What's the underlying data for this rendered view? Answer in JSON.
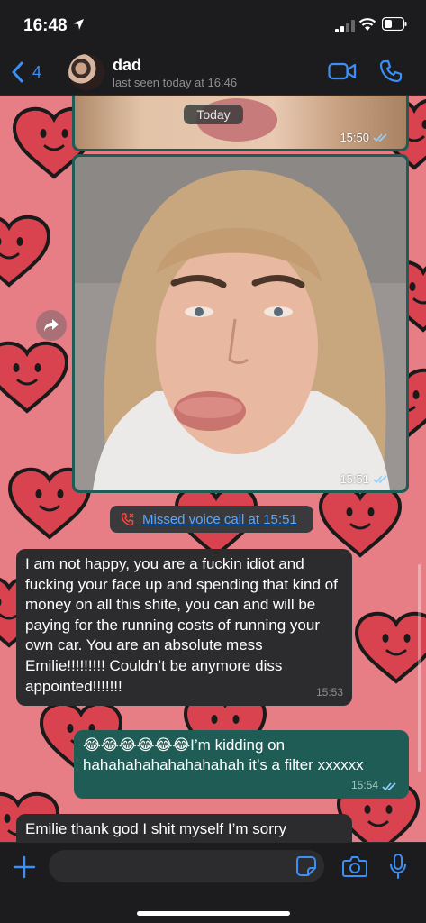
{
  "status_bar": {
    "time": "16:48"
  },
  "header": {
    "back_count": "4",
    "contact_name": "dad",
    "last_seen": "last seen today at 16:46"
  },
  "chat": {
    "date_chip": "Today",
    "photo1_time": "15:50",
    "photo2_time": "15:51",
    "missed_call": "Missed voice call at 15:51",
    "msg1": {
      "text": "I am not happy, you are a fuckin idiot and fucking your face up and spending that kind of money on all this shite, you can and will be paying for the running costs of running your own car. You are an absolute mess Emilie!!!!!!!!! Couldn’t be anymore diss appointed!!!!!!!",
      "time": "15:53"
    },
    "msg2": {
      "text": "😂😂😂😂😂😂I’m kidding on hahahahahahahahahah it’s a filter xxxxxx",
      "time": "15:54"
    },
    "msg3": {
      "text": "Emilie thank god I shit myself I’m sorry"
    }
  },
  "colors": {
    "accent": "#3b8ff5",
    "outgoing_bubble": "#1f5c55",
    "incoming_bubble": "#2c2c2e",
    "wallpaper": "#e77e86"
  },
  "icons": [
    "location-arrow-icon",
    "signal-icon",
    "wifi-icon",
    "battery-icon",
    "chevron-left-icon",
    "video-camera-icon",
    "phone-icon",
    "forward-icon",
    "missed-call-icon",
    "read-ticks-icon",
    "plus-icon",
    "sticker-icon",
    "camera-icon",
    "microphone-icon"
  ]
}
